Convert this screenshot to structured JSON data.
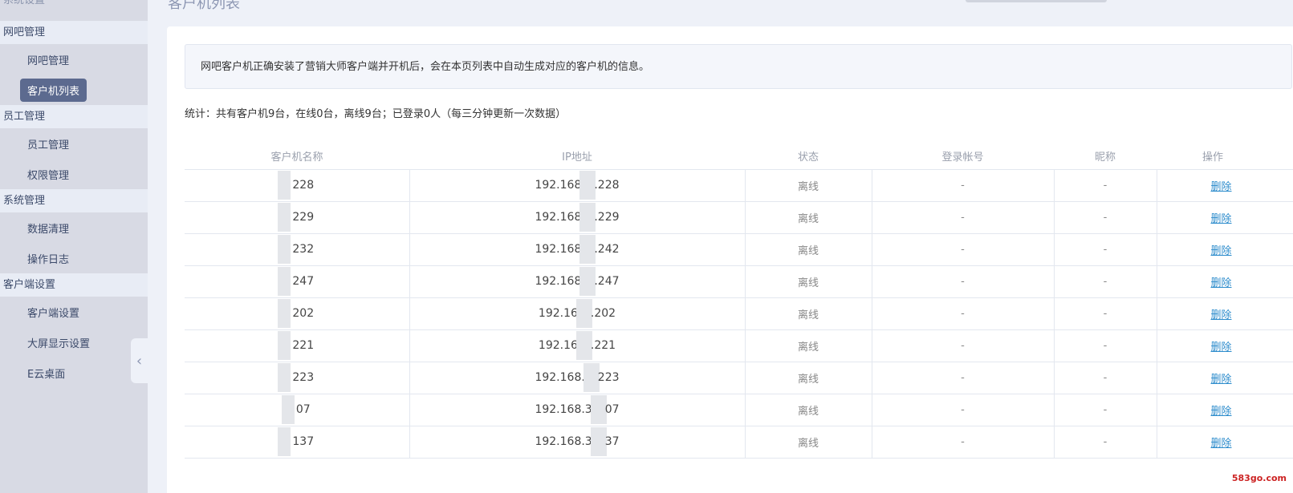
{
  "sidebar": {
    "top_partial": "系统设置",
    "groups": [
      {
        "title": "网吧管理",
        "items": [
          {
            "label": "网吧管理"
          },
          {
            "label": "客户机列表",
            "active": true
          }
        ]
      },
      {
        "title": "员工管理",
        "items": [
          {
            "label": "员工管理"
          },
          {
            "label": "权限管理"
          }
        ]
      },
      {
        "title": "系统管理",
        "items": [
          {
            "label": "数据清理"
          },
          {
            "label": "操作日志"
          }
        ]
      },
      {
        "title": "客户端设置",
        "items": [
          {
            "label": "客户端设置"
          },
          {
            "label": "大屏显示设置"
          },
          {
            "label": "E云桌面"
          }
        ]
      }
    ],
    "collapse_icon": "chevron-left-icon"
  },
  "page": {
    "title": "客户机列表",
    "notice": "网吧客户机正确安装了营销大师客户端并开机后，会在本页列表中自动生成对应的客户机的信息。",
    "stats": "统计：共有客户机9台，在线0台，离线9台；已登录0人（每三分钟更新一次数据）"
  },
  "table": {
    "headers": [
      "客户机名称",
      "IP地址",
      "状态",
      "登录帐号",
      "昵称",
      "操作"
    ],
    "rows": [
      {
        "name": "228",
        "ip_prefix": "192.168",
        "ip_suffix": ".228",
        "status": "离线",
        "account": "-",
        "nick": "-",
        "op": "删除"
      },
      {
        "name": "229",
        "ip_prefix": "192.168",
        "ip_suffix": ".229",
        "status": "离线",
        "account": "-",
        "nick": "-",
        "op": "删除"
      },
      {
        "name": "232",
        "ip_prefix": "192.168",
        "ip_suffix": ".242",
        "status": "离线",
        "account": "-",
        "nick": "-",
        "op": "删除"
      },
      {
        "name": "247",
        "ip_prefix": "192.168",
        "ip_suffix": ".247",
        "status": "离线",
        "account": "-",
        "nick": "-",
        "op": "删除"
      },
      {
        "name": "202",
        "ip_prefix": "192.16",
        "ip_suffix": ".202",
        "status": "离线",
        "account": "-",
        "nick": "-",
        "op": "删除"
      },
      {
        "name": "221",
        "ip_prefix": "192.16",
        "ip_suffix": ".221",
        "status": "离线",
        "account": "-",
        "nick": "-",
        "op": "删除"
      },
      {
        "name": "223",
        "ip_prefix": "192.168.",
        "ip_suffix": "223",
        "status": "离线",
        "account": "-",
        "nick": "-",
        "op": "删除"
      },
      {
        "name": "07",
        "ip_prefix": "192.168.3",
        "ip_suffix": "07",
        "status": "离线",
        "account": "-",
        "nick": "-",
        "op": "删除"
      },
      {
        "name": "137",
        "ip_prefix": "192.168.3",
        "ip_suffix": "37",
        "status": "离线",
        "account": "-",
        "nick": "-",
        "op": "删除"
      }
    ]
  },
  "watermark": "583go.com"
}
